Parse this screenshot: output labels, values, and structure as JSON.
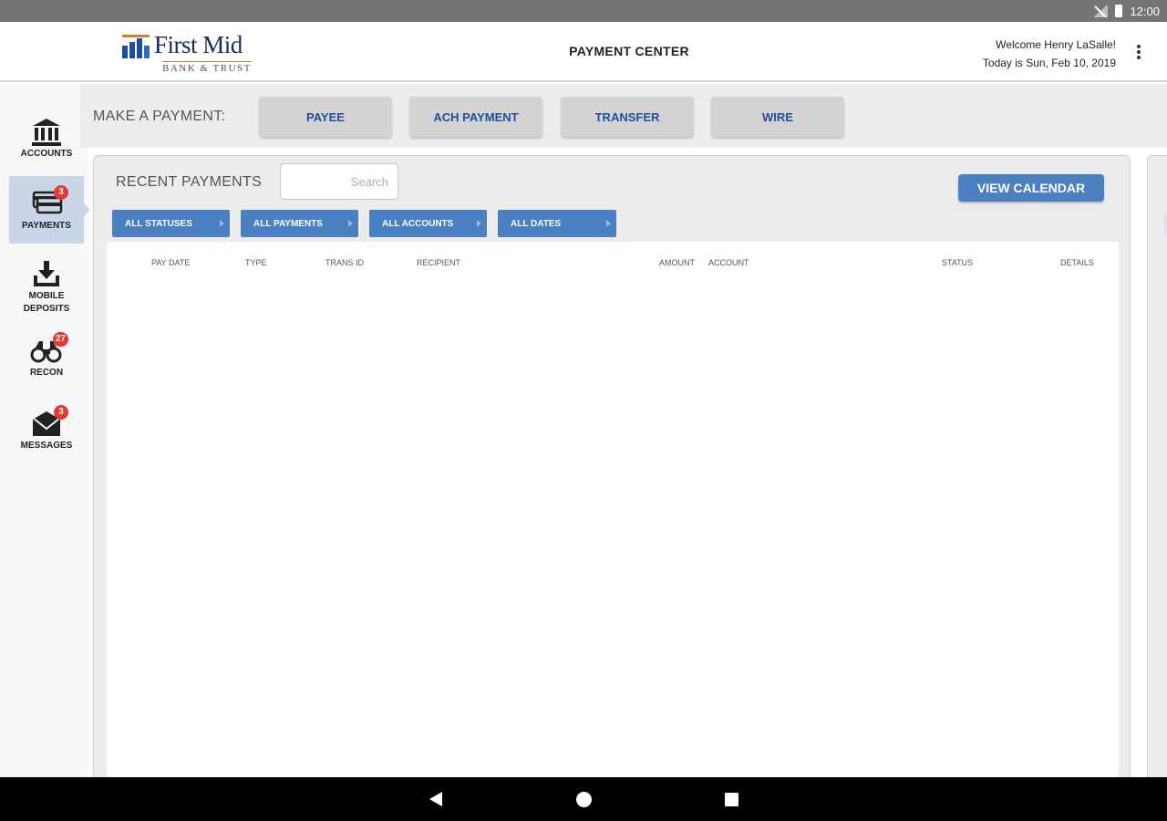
{
  "status_bar": {
    "time": "12:00"
  },
  "header": {
    "brand_name": "First Mid",
    "brand_sub": "BANK & TRUST",
    "title": "PAYMENT CENTER",
    "welcome": "Welcome Henry LaSalle!",
    "date_text": "Today is Sun, Feb 10, 2019"
  },
  "sidebar": {
    "items": [
      {
        "label": "ACCOUNTS",
        "badge": ""
      },
      {
        "label": "PAYMENTS",
        "badge": "3"
      },
      {
        "label": "MOBILE",
        "label2": "DEPOSITS",
        "badge": ""
      },
      {
        "label": "RECON",
        "badge": "27"
      },
      {
        "label": "MESSAGES",
        "badge": "3"
      }
    ]
  },
  "make_payment": {
    "label": "MAKE A PAYMENT:",
    "buttons": [
      "PAYEE",
      "ACH PAYMENT",
      "TRANSFER",
      "WIRE"
    ]
  },
  "recent": {
    "title": "RECENT PAYMENTS",
    "search_placeholder": "Search",
    "view_calendar": "VIEW CALENDAR",
    "filters": [
      "ALL STATUSES",
      "ALL PAYMENTS",
      "ALL ACCOUNTS",
      "ALL DATES"
    ],
    "columns": [
      "PAY DATE",
      "TYPE",
      "TRANS ID",
      "RECIPIENT",
      "AMOUNT",
      "ACCOUNT",
      "STATUS",
      "DETAILS"
    ]
  },
  "colors": {
    "accent": "#4a7fc1",
    "brand_blue": "#1f4e9a",
    "brand_gold": "#c8862b",
    "badge_red": "#e53935"
  },
  "icons": {
    "accounts": "bank-icon",
    "payments": "cards-icon",
    "mobile_deposits": "download-tray-icon",
    "recon": "binoculars-icon",
    "messages": "envelope-icon"
  }
}
